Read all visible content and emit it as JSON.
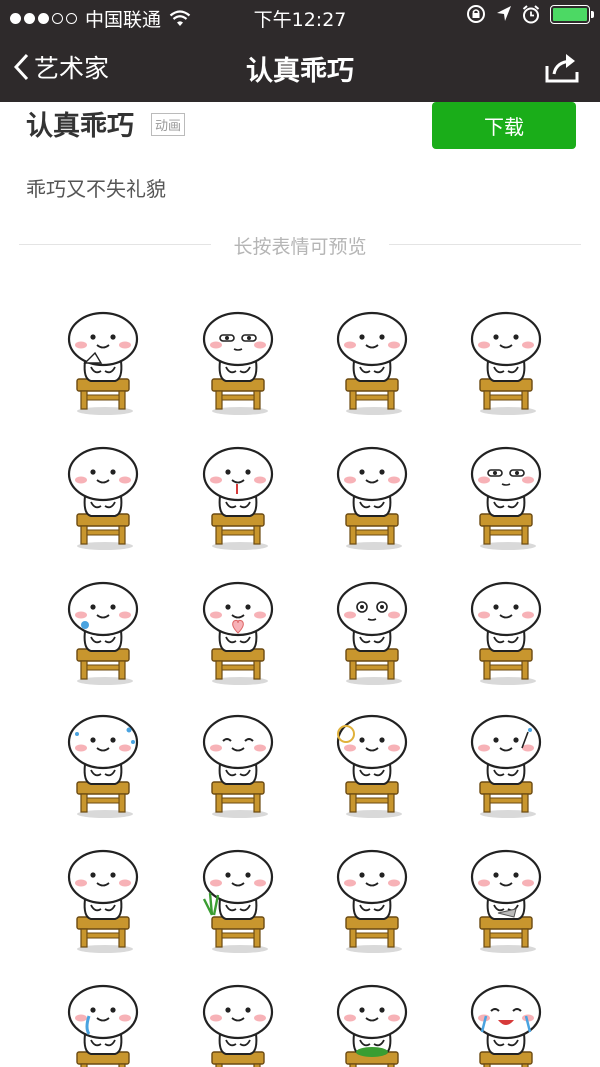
{
  "status_bar": {
    "carrier": "中国联通",
    "time": "下午12:27"
  },
  "navbar": {
    "back_label": "艺术家",
    "title": "认真乖巧"
  },
  "sticker_pack": {
    "name": "认真乖巧",
    "tag": "动画",
    "download_label": "下载",
    "description": "乖巧又不失礼貌",
    "preview_hint": "长按表情可预览"
  },
  "colors": {
    "nav_background": "#2e2a2b",
    "download_button": "#1aad19",
    "battery": "#4cd964",
    "desk_wood": "#c8962e",
    "blush": "#f7b2b7"
  },
  "stickers": [
    {
      "pose": "fan"
    },
    {
      "pose": "staring-eyes"
    },
    {
      "pose": "eating"
    },
    {
      "pose": "typing"
    },
    {
      "pose": "chin-hand"
    },
    {
      "pose": "drooling"
    },
    {
      "pose": "thinking"
    },
    {
      "pose": "staring-eyes"
    },
    {
      "pose": "spit"
    },
    {
      "pose": "heart"
    },
    {
      "pose": "shocked"
    },
    {
      "pose": "shy"
    },
    {
      "pose": "sweat"
    },
    {
      "pose": "smug"
    },
    {
      "pose": "magnifier"
    },
    {
      "pose": "salute"
    },
    {
      "pose": "folded-hands"
    },
    {
      "pose": "plant"
    },
    {
      "pose": "grabbing"
    },
    {
      "pose": "eating-fish"
    },
    {
      "pose": "tears"
    },
    {
      "pose": "smile"
    },
    {
      "pose": "lettuce"
    },
    {
      "pose": "crying-laugh"
    }
  ]
}
